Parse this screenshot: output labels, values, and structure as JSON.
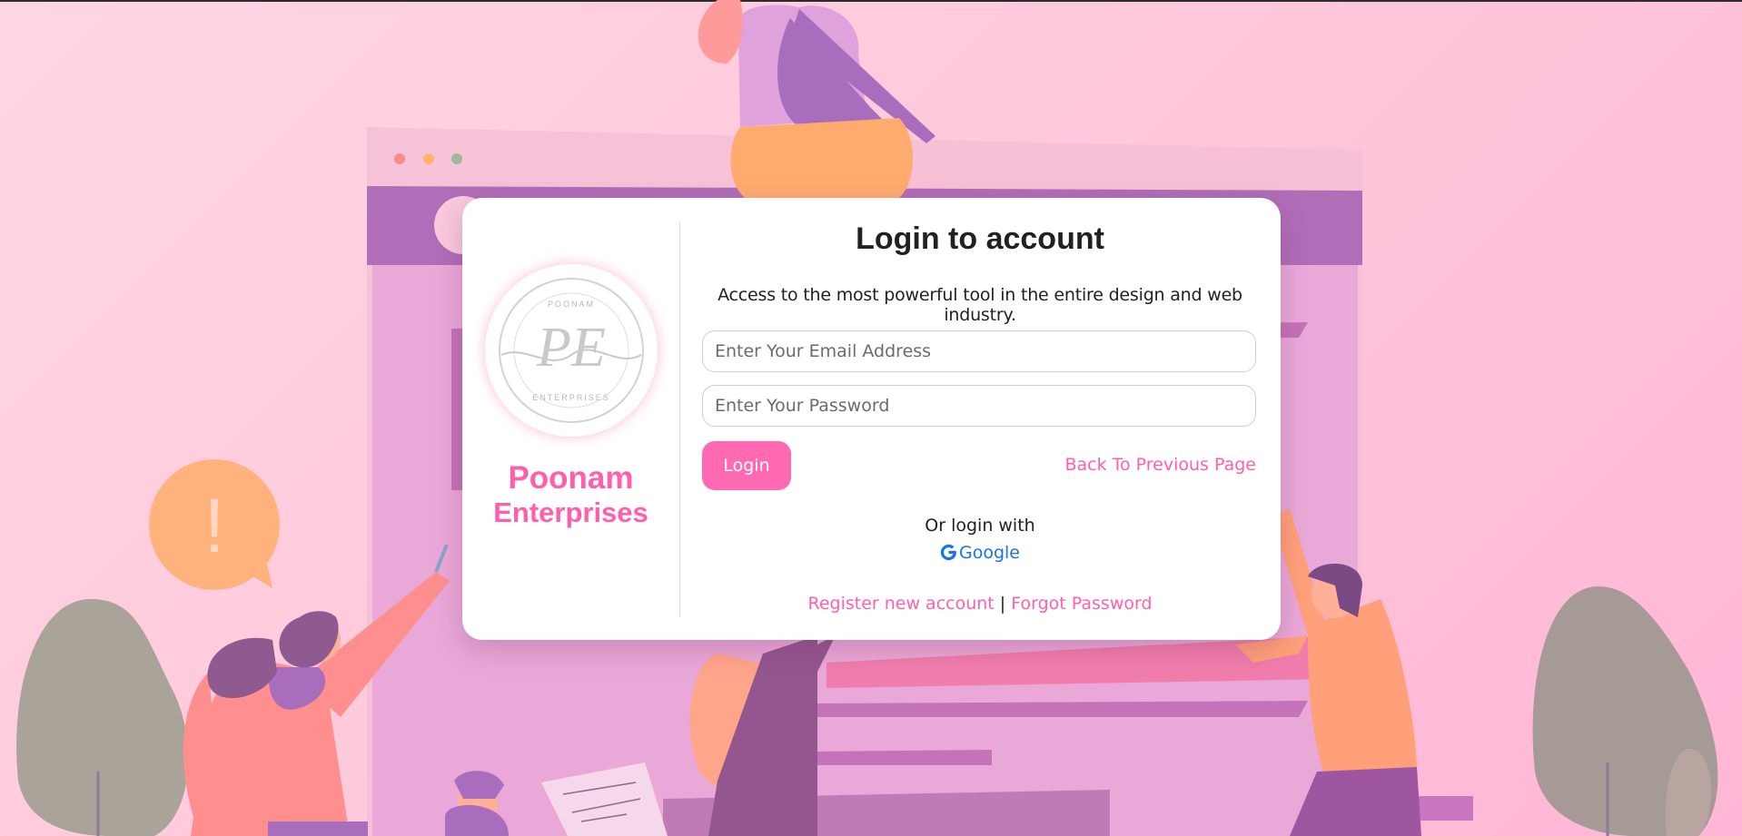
{
  "brand": {
    "logo_alt": "Poonam Enterprises logo",
    "logo_text_top": "POONAM",
    "logo_monogram": "PE",
    "logo_text_bottom": "ENTERPRISES",
    "name_line1": "Poonam",
    "name_line2": "Enterprises",
    "brand_color": "#ff5fad"
  },
  "form": {
    "title": "Login to account",
    "subtitle": "Access to the most powerful tool in the entire design and web industry.",
    "email_placeholder": "Enter Your Email Address",
    "password_placeholder": "Enter Your Password",
    "login_label": "Login",
    "back_label": "Back To Previous Page",
    "or_login_with": "Or login with",
    "google_label": "Google",
    "register_label": "Register new account",
    "separator": "|",
    "forgot_label": "Forgot Password"
  },
  "background": {
    "alert_symbol": "!"
  },
  "colors": {
    "accent": "#ff69b4",
    "google_blue": "#1a73e8",
    "bg_pink": "#ffc9dc"
  }
}
